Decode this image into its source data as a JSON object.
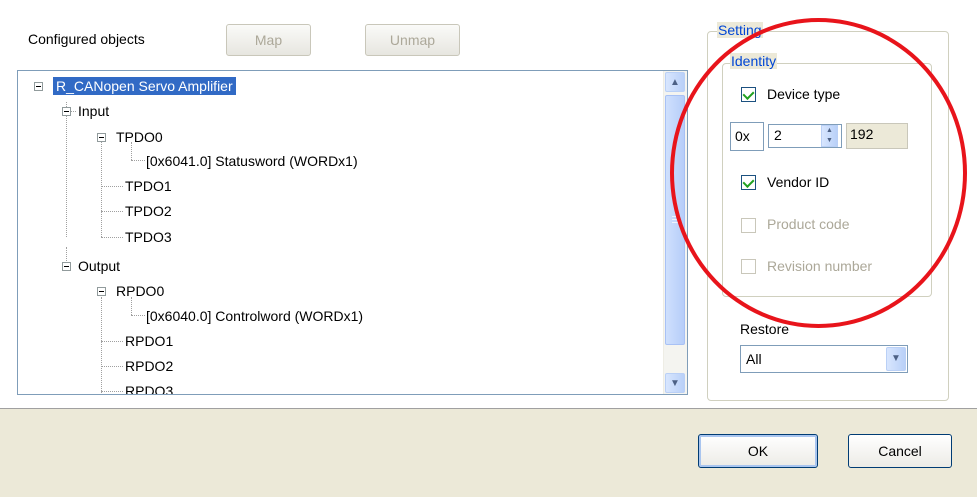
{
  "configured_objects_label": "Configured objects",
  "buttons": {
    "map": "Map",
    "unmap": "Unmap",
    "ok": "OK",
    "cancel": "Cancel"
  },
  "tree": {
    "root": "R_CANopen Servo Amplifier",
    "input": "Input",
    "tpdo0": "TPDO0",
    "statusword": "[0x6041.0] Statusword   (WORDx1)",
    "tpdo1": "TPDO1",
    "tpdo2": "TPDO2",
    "tpdo3": "TPDO3",
    "output": "Output",
    "rpdo0": "RPDO0",
    "controlword": "[0x6040.0] Controlword   (WORDx1)",
    "rpdo1": "RPDO1",
    "rpdo2": "RPDO2",
    "rpdo3": "RPDO3"
  },
  "setting": {
    "legend": "Setting",
    "identity_legend": "Identity",
    "device_type": {
      "label": "Device type",
      "checked": true
    },
    "hex_prefix": "0x",
    "device_type_value": "2",
    "device_type_readonly": "192",
    "vendor_id": {
      "label": "Vendor ID",
      "checked": true
    },
    "product_code": {
      "label": "Product code",
      "checked": false
    },
    "revision_number": {
      "label": "Revision number",
      "checked": false
    },
    "restore_label": "Restore",
    "restore_value": "All"
  },
  "annotation_color": "#e8141b"
}
